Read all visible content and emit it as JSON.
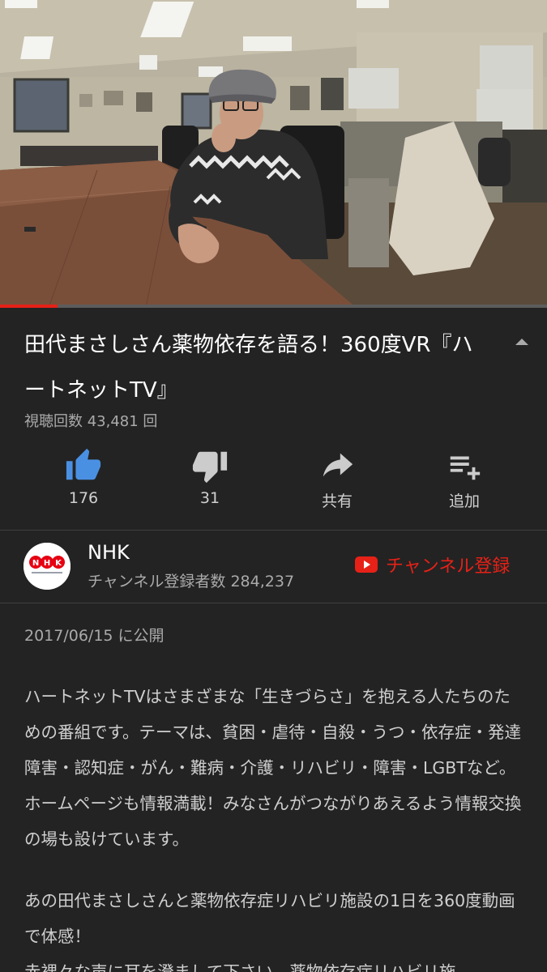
{
  "video": {
    "progress_fraction": 0.105
  },
  "title": {
    "text": "田代まさしさん薬物依存を語る！360度VR『ハートネットTV』",
    "views": "視聴回数 43,481 回"
  },
  "actions": [
    {
      "icon": "thumbs-up-icon",
      "label": "176",
      "color": "#4a90e2"
    },
    {
      "icon": "thumbs-down-icon",
      "label": "31",
      "color": "#cccccc"
    },
    {
      "icon": "share-icon",
      "label": "共有",
      "color": "#cccccc"
    },
    {
      "icon": "add-to-playlist-icon",
      "label": "追加",
      "color": "#cccccc"
    }
  ],
  "channel": {
    "name": "NHK",
    "subscribers": "チャンネル登録者数 284,237",
    "subscribe_label": "チャンネル登録",
    "logo_text": "NHK"
  },
  "description": {
    "published": "2017/06/15 に公開",
    "paragraph1": "ハートネットTVはさまざまな「生きづらさ」を抱える人たちのための番組です。テーマは、貧困・虐待・自殺・うつ・依存症・発達障害・認知症・がん・難病・介護・リハビリ・障害・LGBTなど。ホームページも情報満載！みなさんがつながりあえるよう情報交換の場も設けています。",
    "paragraph2_line1": "あの田代まさしさんと薬物依存症リハビリ施設の1日を360度動画で体感！",
    "paragraph2_line2": "赤裸々な声に耳を澄まして下さい。薬物依存症リハビリ施"
  },
  "colors": {
    "background": "#232323",
    "accent_red": "#e62117",
    "like_blue": "#4a90e2"
  }
}
